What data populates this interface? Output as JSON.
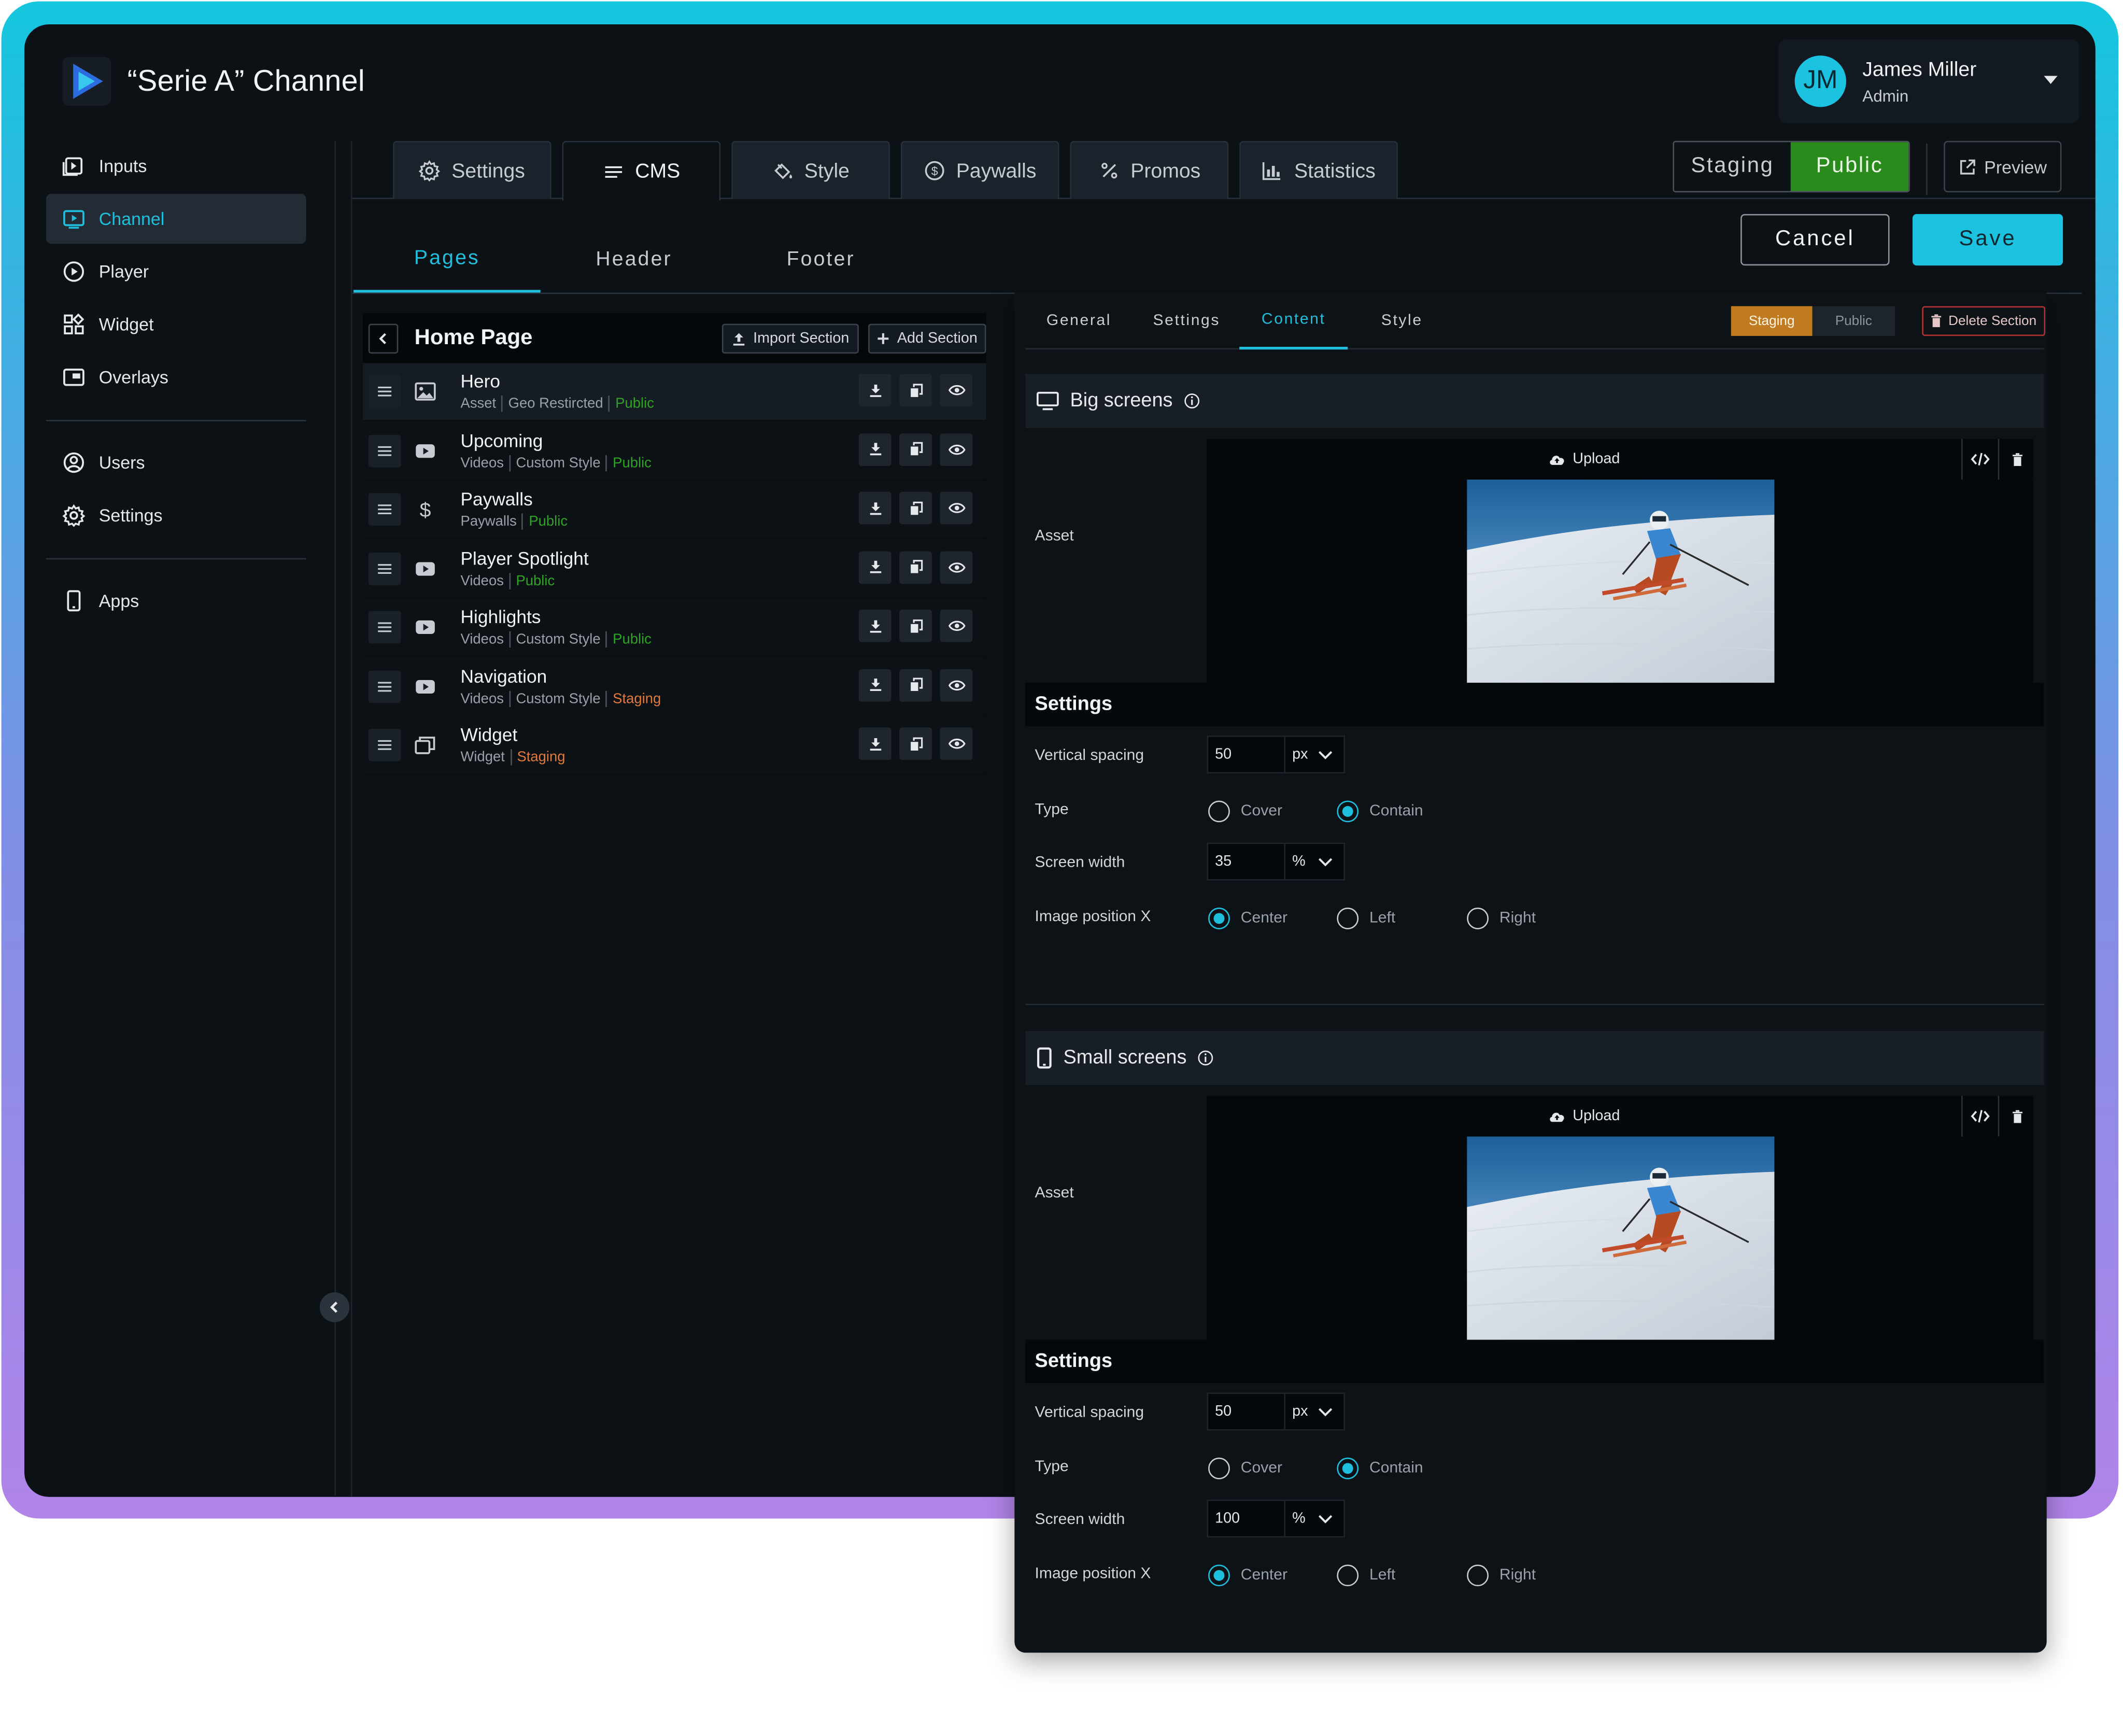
{
  "header": {
    "channel_title": "“Serie A” Channel"
  },
  "user": {
    "initials": "JM",
    "name": "James Miller",
    "role": "Admin"
  },
  "sidebar": {
    "items": [
      {
        "label": "Inputs",
        "icon": "inputs-icon"
      },
      {
        "label": "Channel",
        "icon": "channel-icon",
        "active": true
      },
      {
        "label": "Player",
        "icon": "player-icon"
      },
      {
        "label": "Widget",
        "icon": "widget-icon"
      },
      {
        "label": "Overlays",
        "icon": "overlays-icon"
      },
      {
        "label": "Users",
        "icon": "users-icon"
      },
      {
        "label": "Settings",
        "icon": "settings-icon"
      },
      {
        "label": "Apps",
        "icon": "apps-icon"
      }
    ]
  },
  "main_tabs": [
    {
      "label": "Settings",
      "icon": "gear-icon"
    },
    {
      "label": "CMS",
      "icon": "list-icon",
      "active": true
    },
    {
      "label": "Style",
      "icon": "paint-bucket-icon"
    },
    {
      "label": "Paywalls",
      "icon": "dollar-circle-icon"
    },
    {
      "label": "Promos",
      "icon": "percent-icon"
    },
    {
      "label": "Statistics",
      "icon": "bar-chart-icon"
    }
  ],
  "environment": {
    "staging_label": "Staging",
    "public_label": "Public",
    "selected": "Public"
  },
  "preview_label": "Preview",
  "sub_tabs": [
    {
      "label": "Pages",
      "active": true
    },
    {
      "label": "Header"
    },
    {
      "label": "Footer"
    }
  ],
  "actions": {
    "cancel": "Cancel",
    "save": "Save"
  },
  "page": {
    "title": "Home Page",
    "import_label": "Import Section",
    "add_label": "Add Section",
    "sections": [
      {
        "name": "Hero",
        "icon": "image-icon",
        "tags": [
          "Asset",
          "Geo Restircted"
        ],
        "status": "Public"
      },
      {
        "name": "Upcoming",
        "icon": "video-icon",
        "tags": [
          "Videos",
          "Custom Style"
        ],
        "status": "Public"
      },
      {
        "name": "Paywalls",
        "icon": "dollar-icon",
        "tags": [
          "Paywalls"
        ],
        "status": "Public"
      },
      {
        "name": "Player Spotlight",
        "icon": "video-icon",
        "tags": [
          "Videos"
        ],
        "status": "Public"
      },
      {
        "name": "Highlights",
        "icon": "video-icon",
        "tags": [
          "Videos",
          "Custom Style"
        ],
        "status": "Public"
      },
      {
        "name": "Navigation",
        "icon": "video-icon",
        "tags": [
          "Videos",
          "Custom Style"
        ],
        "status": "Staging"
      },
      {
        "name": "Widget",
        "icon": "widget-stack-icon",
        "tags": [
          "Widget"
        ],
        "status": "Staging"
      }
    ]
  },
  "editor": {
    "tabs": [
      {
        "label": "General"
      },
      {
        "label": "Settings"
      },
      {
        "label": "Content",
        "active": true
      },
      {
        "label": "Style"
      }
    ],
    "env": {
      "staging": "Staging",
      "public": "Public",
      "selected": "Staging"
    },
    "delete_label": "Delete Section",
    "big": {
      "title": "Big screens",
      "asset_label": "Asset",
      "upload_label": "Upload",
      "settings_title": "Settings",
      "vertical_spacing_label": "Vertical spacing",
      "vertical_spacing": "50",
      "vertical_spacing_unit": "px",
      "type_label": "Type",
      "type_options": [
        "Cover",
        "Contain"
      ],
      "type_selected": "Contain",
      "screen_width_label": "Screen width",
      "screen_width": "35",
      "screen_width_unit": "%",
      "image_pos_label": "Image position X",
      "image_pos_options": [
        "Center",
        "Left",
        "Right"
      ],
      "image_pos_selected": "Center"
    },
    "small": {
      "title": "Small screens",
      "asset_label": "Asset",
      "upload_label": "Upload",
      "settings_title": "Settings",
      "vertical_spacing_label": "Vertical spacing",
      "vertical_spacing": "50",
      "vertical_spacing_unit": "px",
      "type_label": "Type",
      "type_options": [
        "Cover",
        "Contain"
      ],
      "type_selected": "Contain",
      "screen_width_label": "Screen width",
      "screen_width": "100",
      "screen_width_unit": "%",
      "image_pos_label": "Image position X",
      "image_pos_options": [
        "Center",
        "Left",
        "Right"
      ],
      "image_pos_selected": "Center"
    }
  },
  "colors": {
    "accent": "#1bc3e0",
    "public_green": "#2a8b1d",
    "staging_orange": "#c07a1f",
    "danger": "#b13232",
    "background": "#0c1116"
  }
}
